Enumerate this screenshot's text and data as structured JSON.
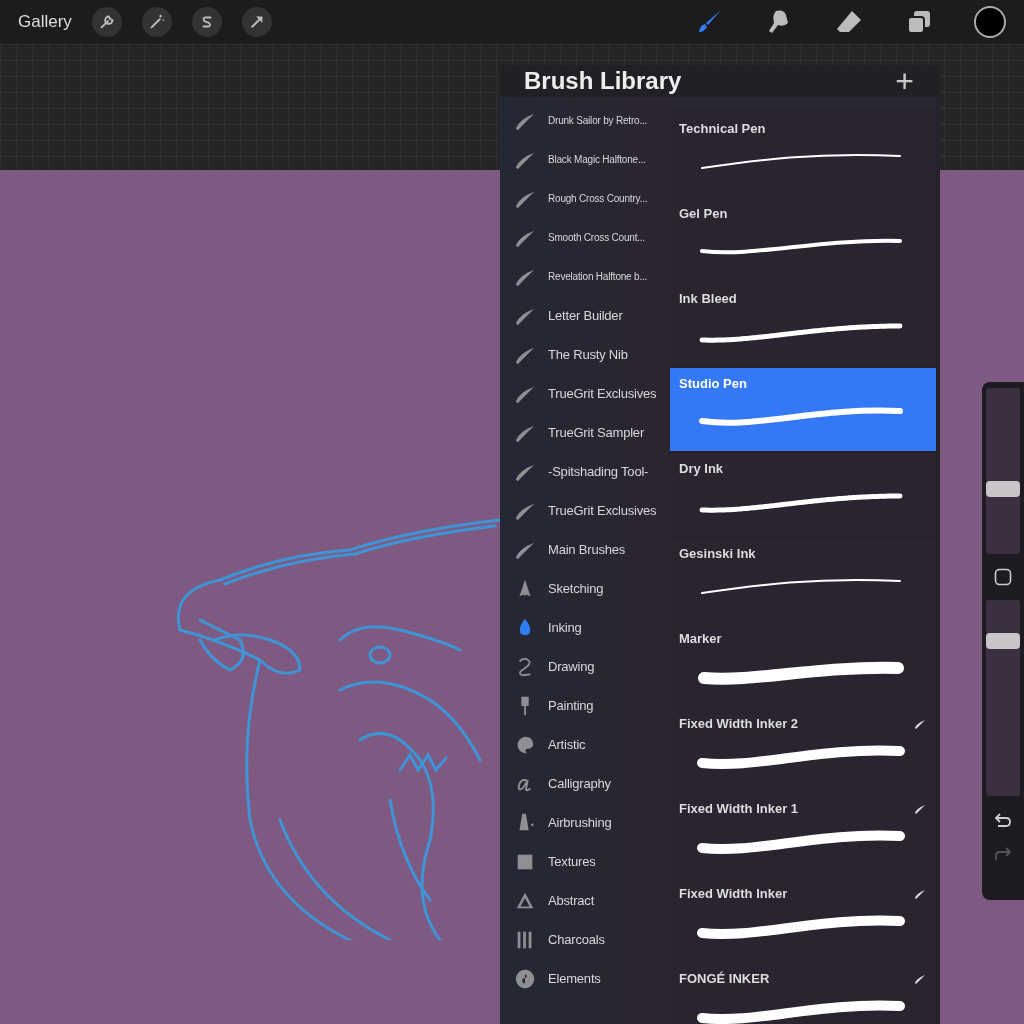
{
  "toolbar": {
    "gallery": "Gallery",
    "left_tools": [
      {
        "kind": "wrench"
      },
      {
        "kind": "wand"
      },
      {
        "kind": "selection"
      },
      {
        "kind": "arrow"
      }
    ],
    "right_tools": [
      {
        "kind": "brush",
        "selected": true
      },
      {
        "kind": "smudge",
        "selected": false
      },
      {
        "kind": "eraser",
        "selected": false
      },
      {
        "kind": "layers",
        "selected": false
      }
    ],
    "color_well": {
      "color": "#000000"
    }
  },
  "brush_library": {
    "title": "Brush Library",
    "add": "+",
    "sets": [
      {
        "label": "Drunk Sailor by Retro...",
        "kind": "imported",
        "small_text": true,
        "selected": false
      },
      {
        "label": "Black Magic Halftone...",
        "kind": "imported",
        "small_text": true,
        "selected": false
      },
      {
        "label": "Rough Cross Country...",
        "kind": "imported",
        "small_text": true,
        "selected": false
      },
      {
        "label": "Smooth Cross Count...",
        "kind": "imported",
        "small_text": true,
        "selected": false
      },
      {
        "label": "Revelation Halftone b...",
        "kind": "imported",
        "small_text": true,
        "selected": false
      },
      {
        "label": "Letter Builder",
        "kind": "imported",
        "small_text": false,
        "selected": false
      },
      {
        "label": "The Rusty Nib",
        "kind": "imported",
        "small_text": false,
        "selected": false
      },
      {
        "label": "TrueGrit Exclusives",
        "kind": "imported",
        "small_text": false,
        "selected": false
      },
      {
        "label": "TrueGrit Sampler",
        "kind": "imported",
        "small_text": false,
        "selected": false
      },
      {
        "label": "-Spitshading Tool-",
        "kind": "imported",
        "small_text": false,
        "selected": false
      },
      {
        "label": "TrueGrit Exclusives",
        "kind": "imported",
        "small_text": false,
        "selected": false
      },
      {
        "label": "Main Brushes",
        "kind": "imported",
        "small_text": false,
        "selected": false
      },
      {
        "label": "Sketching",
        "kind": "pencil",
        "small_text": false,
        "selected": false
      },
      {
        "label": "Inking",
        "kind": "nib",
        "small_text": false,
        "selected": true
      },
      {
        "label": "Drawing",
        "kind": "squiggle",
        "small_text": false,
        "selected": false
      },
      {
        "label": "Painting",
        "kind": "paintbrush",
        "small_text": false,
        "selected": false
      },
      {
        "label": "Artistic",
        "kind": "palette",
        "small_text": false,
        "selected": false
      },
      {
        "label": "Calligraphy",
        "kind": "script",
        "small_text": false,
        "selected": false
      },
      {
        "label": "Airbrushing",
        "kind": "airbrush",
        "small_text": false,
        "selected": false
      },
      {
        "label": "Textures",
        "kind": "hatch",
        "small_text": false,
        "selected": false
      },
      {
        "label": "Abstract",
        "kind": "triangle",
        "small_text": false,
        "selected": false
      },
      {
        "label": "Charcoals",
        "kind": "bars",
        "small_text": false,
        "selected": false
      },
      {
        "label": "Elements",
        "kind": "yinyang",
        "small_text": false,
        "selected": false
      }
    ],
    "brushes": [
      {
        "name": "Technical Pen",
        "kind": "hairline",
        "imported": false,
        "selected": false
      },
      {
        "name": "Gel Pen",
        "kind": "medium",
        "imported": false,
        "selected": false
      },
      {
        "name": "Ink Bleed",
        "kind": "rough",
        "imported": false,
        "selected": false
      },
      {
        "name": "Studio Pen",
        "kind": "tapered",
        "imported": false,
        "selected": true
      },
      {
        "name": "Dry Ink",
        "kind": "rough",
        "imported": false,
        "selected": false
      },
      {
        "name": "Gesinski Ink",
        "kind": "hairline",
        "imported": false,
        "selected": false
      },
      {
        "name": "Marker",
        "kind": "marker",
        "imported": false,
        "selected": false
      },
      {
        "name": "Fixed Width Inker 2",
        "kind": "thick",
        "imported": true,
        "selected": false
      },
      {
        "name": "Fixed Width Inker 1",
        "kind": "thick",
        "imported": true,
        "selected": false
      },
      {
        "name": "Fixed Width Inker",
        "kind": "thick",
        "imported": true,
        "selected": false
      },
      {
        "name": "FONGÉ INKER",
        "kind": "thick",
        "imported": true,
        "selected": false
      }
    ]
  },
  "sidebar": {
    "size": {
      "level": 0.37
    },
    "opacity": {
      "level": 0.81
    }
  }
}
